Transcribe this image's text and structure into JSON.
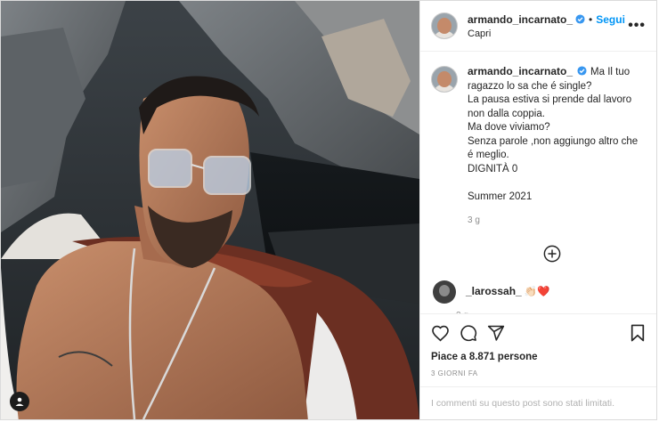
{
  "post": {
    "username": "armando_incarnato_",
    "follow_label": "Segui",
    "separator": "•",
    "location": "Capri",
    "more_label": "•••"
  },
  "caption": {
    "username": "armando_incarnato_",
    "lines": [
      "Ma Il tuo ragazzo lo sa che é single?",
      "La pausa estiva si prende dal lavoro non dalla coppia.",
      "Ma dove viviamo?",
      "Senza parole ,non aggiungo altro che é meglio.",
      "DIGNITÀ 0",
      "",
      "Summer 2021"
    ],
    "age": "3 g"
  },
  "comments": [
    {
      "username": "_larossah_",
      "text": "👏🏻❤️",
      "age": "2 g"
    }
  ],
  "actions": {
    "likes": "Piace a 8.871 persone",
    "date": "3 GIORNI FA"
  },
  "footer": {
    "limited_text": "I commenti su questo post sono stati limitati."
  },
  "colors": {
    "accent": "#0095f6",
    "muted": "#8e8e8e",
    "border": "#efefef"
  },
  "icons": [
    "verified-icon",
    "more-icon",
    "add-circle-icon",
    "heart-icon",
    "comment-icon",
    "share-icon",
    "bookmark-icon",
    "user-tag-icon"
  ]
}
